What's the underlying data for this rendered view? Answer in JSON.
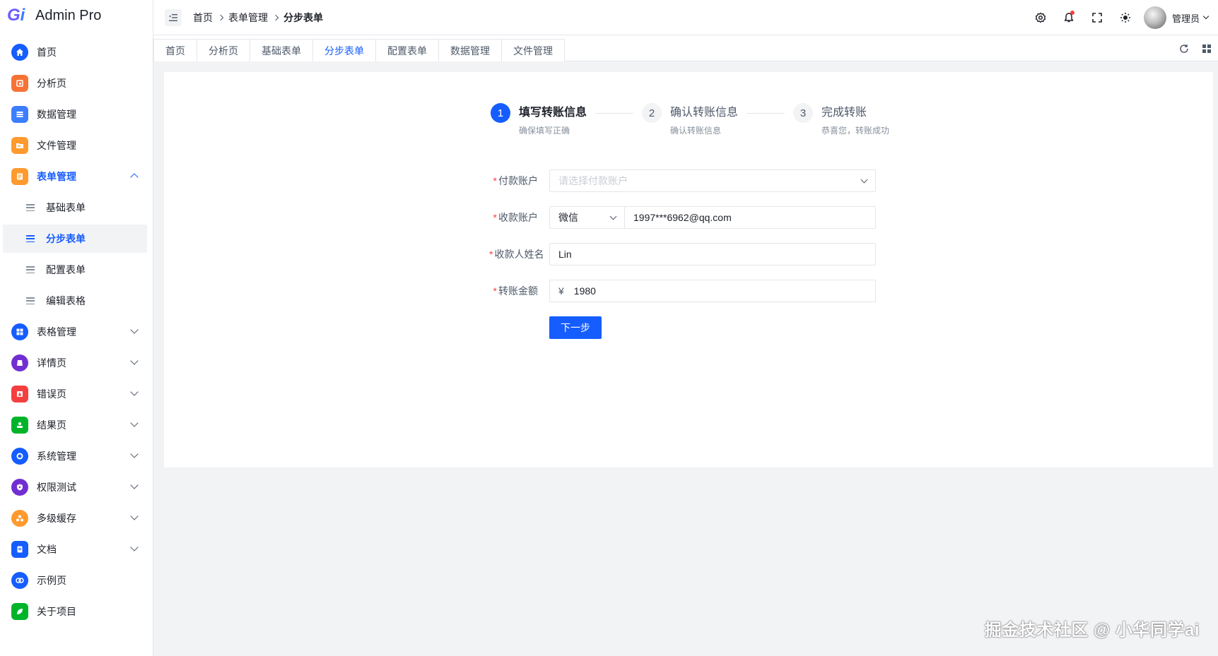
{
  "app": {
    "title": "Admin Pro"
  },
  "sidebar": {
    "items": [
      {
        "label": "首页",
        "icon": "home-icon",
        "color": "#165dff"
      },
      {
        "label": "分析页",
        "icon": "analysis-icon",
        "color": "#f77234"
      },
      {
        "label": "数据管理",
        "icon": "data-icon",
        "color": "#3c7eff"
      },
      {
        "label": "文件管理",
        "icon": "folder-icon",
        "color": "#ff9a2e"
      },
      {
        "label": "表单管理",
        "icon": "form-icon",
        "color": "#ff9a2e"
      },
      {
        "label": "表格管理",
        "icon": "table-icon",
        "color": "#165dff"
      },
      {
        "label": "详情页",
        "icon": "detail-icon",
        "color": "#722ed1"
      },
      {
        "label": "错误页",
        "icon": "error-icon",
        "color": "#f53f3f"
      },
      {
        "label": "结果页",
        "icon": "result-icon",
        "color": "#00b42a"
      },
      {
        "label": "系统管理",
        "icon": "gear-icon",
        "color": "#165dff"
      },
      {
        "label": "权限测试",
        "icon": "shield-icon",
        "color": "#722ed1"
      },
      {
        "label": "多级缓存",
        "icon": "cache-icon",
        "color": "#ff9a2e"
      },
      {
        "label": "文档",
        "icon": "doc-icon",
        "color": "#165dff"
      },
      {
        "label": "示例页",
        "icon": "example-icon",
        "color": "#165dff"
      },
      {
        "label": "关于项目",
        "icon": "leaf-icon",
        "color": "#00b42a"
      }
    ],
    "sub_items": [
      {
        "label": "基础表单"
      },
      {
        "label": "分步表单"
      },
      {
        "label": "配置表单"
      },
      {
        "label": "编辑表格"
      }
    ]
  },
  "header": {
    "breadcrumb": [
      "首页",
      "表单管理",
      "分步表单"
    ],
    "user_name": "管理员"
  },
  "tabs": [
    "首页",
    "分析页",
    "基础表单",
    "分步表单",
    "配置表单",
    "数据管理",
    "文件管理"
  ],
  "steps": [
    {
      "num": "1",
      "title": "填写转账信息",
      "desc": "确保填写正确"
    },
    {
      "num": "2",
      "title": "确认转账信息",
      "desc": "确认转账信息"
    },
    {
      "num": "3",
      "title": "完成转账",
      "desc": "恭喜您，转账成功"
    }
  ],
  "form": {
    "required_mark": "*",
    "pay_account": {
      "label": "付款账户",
      "placeholder": "请选择付款账户"
    },
    "receive_account": {
      "label": "收款账户",
      "type": "微信",
      "value": "1997***6962@qq.com"
    },
    "receiver_name": {
      "label": "收款人姓名",
      "value": "Lin"
    },
    "amount": {
      "label": "转账金额",
      "prefix": "¥",
      "value": "1980"
    },
    "next_button": "下一步"
  },
  "watermark": "掘金技术社区 @ 小华同学ai",
  "colors": {
    "primary": "#165dff",
    "danger": "#f53f3f",
    "bg": "#f2f3f5"
  }
}
